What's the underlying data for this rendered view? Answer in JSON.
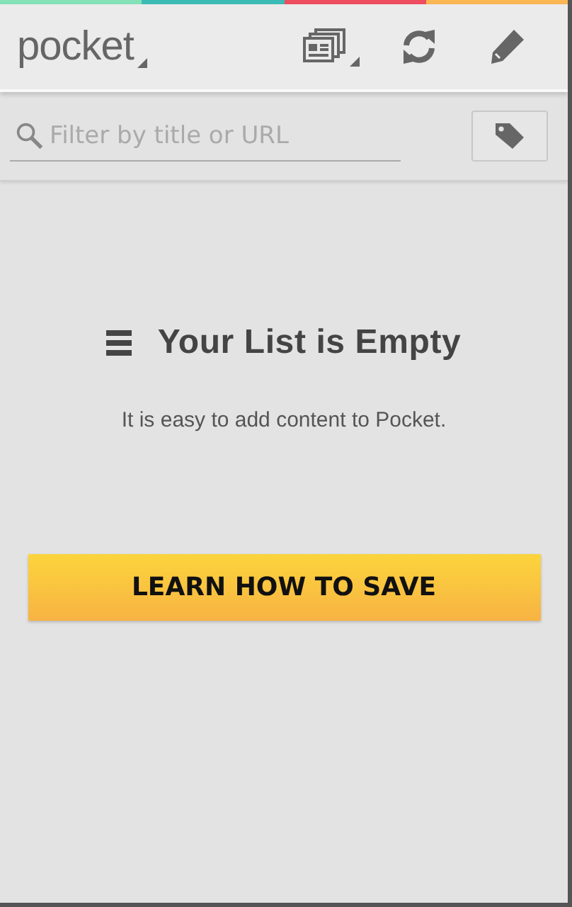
{
  "app_bar": {
    "logo": "pocket"
  },
  "filter": {
    "placeholder": "Filter by title or URL"
  },
  "empty_state": {
    "title": "Your List is Empty",
    "message": "It is easy to add content to Pocket."
  },
  "button": {
    "label": "LEARN HOW TO SAVE"
  }
}
